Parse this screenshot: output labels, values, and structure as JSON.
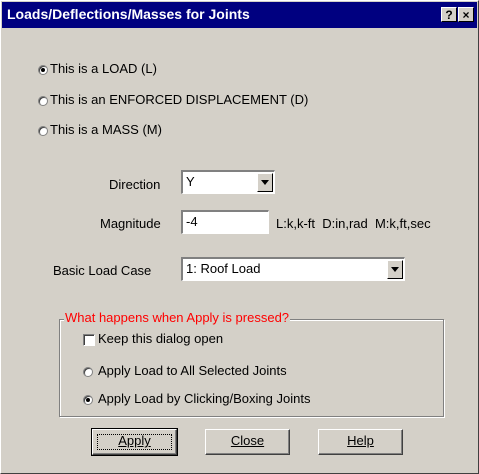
{
  "window": {
    "title": "Loads/Deflections/Masses for Joints",
    "help_glyph": "?",
    "close_glyph": "×"
  },
  "type_options": [
    {
      "label": "This is a LOAD (L)",
      "selected": true
    },
    {
      "label": "This is an ENFORCED DISPLACEMENT (D)",
      "selected": false
    },
    {
      "label": "This is a MASS (M)",
      "selected": false
    }
  ],
  "direction": {
    "label": "Direction",
    "value": "Y"
  },
  "magnitude": {
    "label": "Magnitude",
    "value": "-4",
    "units": "L:k,k-ft  D:in,rad  M:k,ft,sec"
  },
  "load_case": {
    "label": "Basic Load Case",
    "value": "1: Roof Load"
  },
  "apply_group": {
    "label": "What happens when Apply is pressed?",
    "keep_open": {
      "label": "Keep this dialog open",
      "checked": false
    },
    "options": [
      {
        "label": "Apply Load to All Selected Joints",
        "selected": false
      },
      {
        "label": "Apply Load by Clicking/Boxing Joints",
        "selected": true
      }
    ]
  },
  "buttons": {
    "apply": "Apply",
    "close": "Close",
    "help": "Help"
  },
  "colors": {
    "title_bar": "#000080",
    "group_label": "#ff0000",
    "face": "#d4d0c8"
  }
}
